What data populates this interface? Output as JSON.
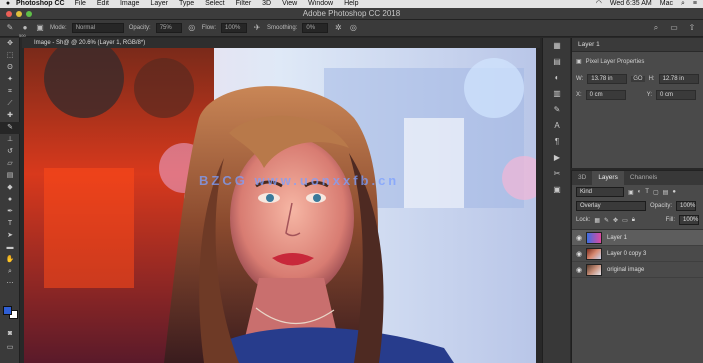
{
  "menubar": {
    "apple": "",
    "app_name": "Photoshop CC",
    "items": [
      "File",
      "Edit",
      "Image",
      "Layer",
      "Type",
      "Select",
      "Filter",
      "3D",
      "View",
      "Window",
      "Help"
    ],
    "clock": "Wed 6:35 AM",
    "user": "Mac"
  },
  "window": {
    "title": "Adobe Photoshop CC 2018"
  },
  "options": {
    "brush_size": "500",
    "mode_label": "Mode:",
    "mode_value": "Normal",
    "opacity_label": "Opacity:",
    "opacity_value": "75%",
    "flow_label": "Flow:",
    "flow_value": "100%",
    "smoothing_label": "Smoothing:",
    "smoothing_value": "0%"
  },
  "document": {
    "tab_label": "Image - Sh@ @ 20.6% (Layer 1, RGB/8*)"
  },
  "canvas": {
    "watermark": "BZCG www.uonxxfb.cn"
  },
  "properties": {
    "tab": "Layer 1",
    "header": "Pixel Layer Properties",
    "w_label": "W:",
    "w_value": "13.78 in",
    "h_label": "H:",
    "h_value": "12.78 in",
    "x_label": "X:",
    "x_value": "0 cm",
    "y_label": "Y:",
    "y_value": "0 cm",
    "link_label": "GO"
  },
  "layers_panel": {
    "tabs": [
      "3D",
      "Layers",
      "Channels"
    ],
    "active_tab": "Layers",
    "kind_label": "Kind",
    "blend_mode": "Overlay",
    "opacity_label": "Opacity:",
    "opacity_value": "100%",
    "lock_label": "Lock:",
    "fill_label": "Fill:",
    "fill_value": "100%",
    "layers": [
      {
        "name": "Layer 1",
        "selected": true
      },
      {
        "name": "Layer 0 copy 3",
        "selected": false
      },
      {
        "name": "original image",
        "selected": false
      }
    ]
  },
  "colors": {
    "foreground": "#2f5fd6",
    "background": "#ffffff",
    "accent_selection": "#5d5d5d"
  }
}
